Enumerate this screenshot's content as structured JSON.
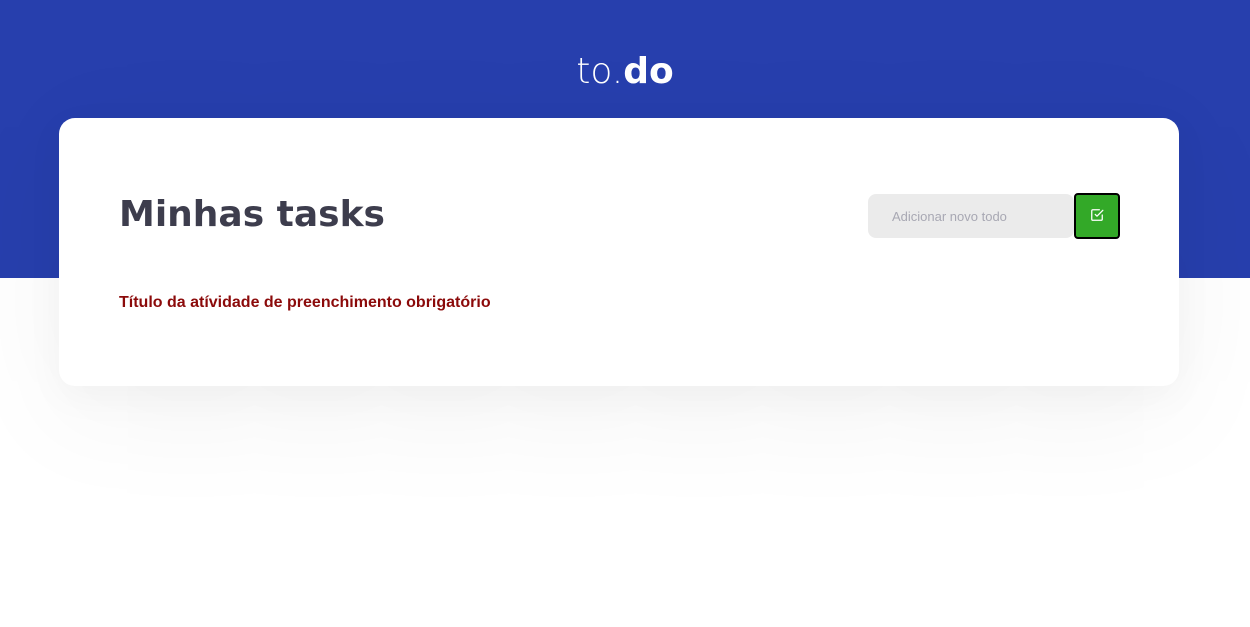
{
  "header": {
    "logo_light": "to.",
    "logo_bold": "do"
  },
  "main": {
    "title": "Minhas tasks",
    "input": {
      "value": "",
      "placeholder": "Adicionar novo todo"
    },
    "add_button_icon": "check-square-icon",
    "error_message": "Título da atívidade de preenchimento obrigatório"
  },
  "colors": {
    "header_bg": "#273fad",
    "button_bg": "#33a928",
    "error_text": "#8b0a0a",
    "title_text": "#3d3d4d"
  }
}
